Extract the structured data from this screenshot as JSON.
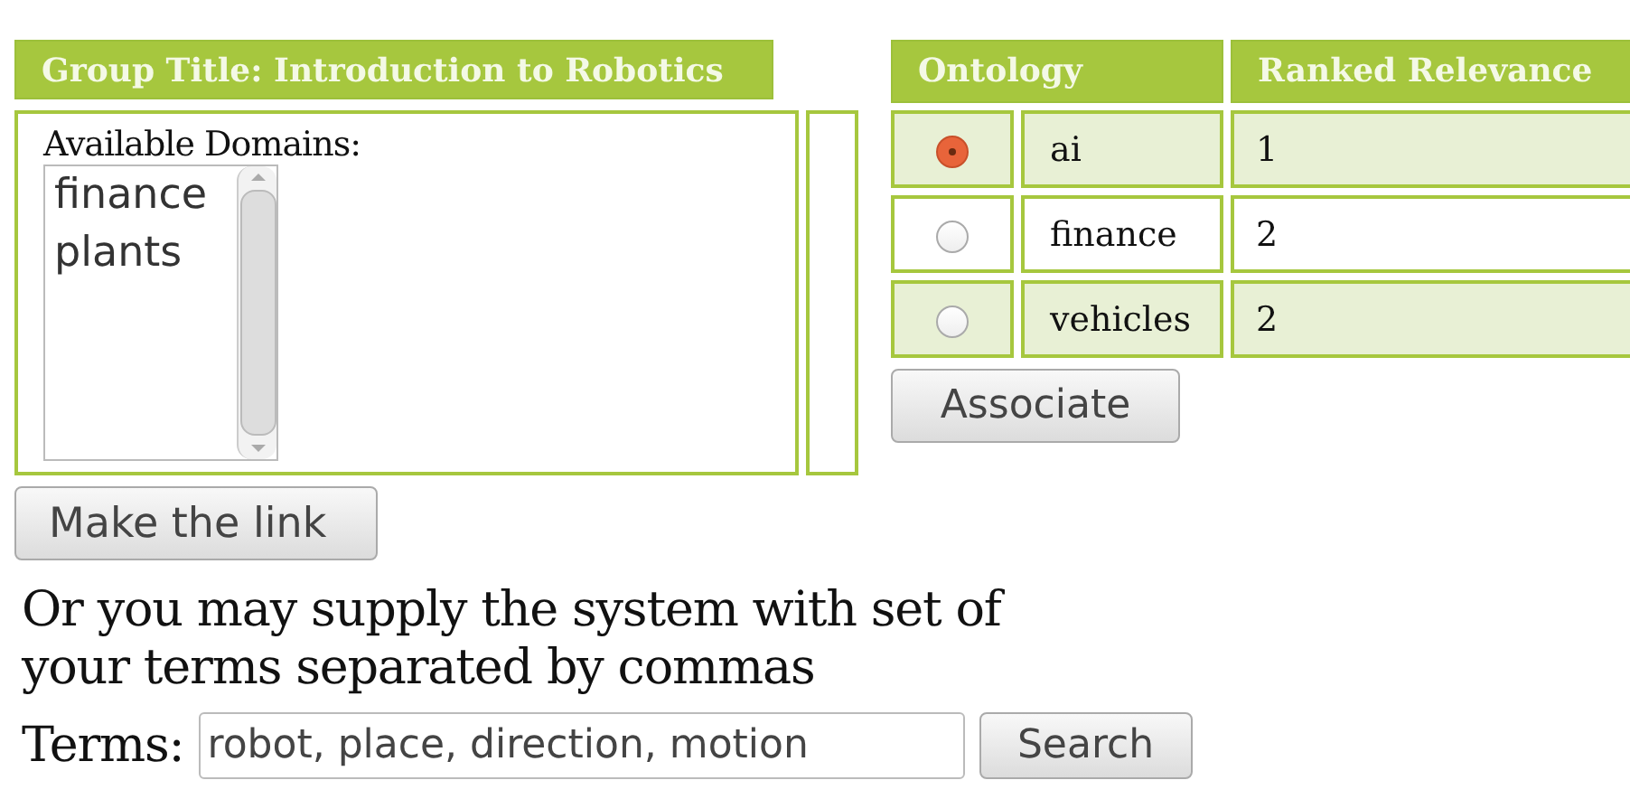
{
  "group": {
    "title": "Group Title: Introduction to Robotics",
    "domains_label": "Available Domains:",
    "domains": [
      "finance",
      "plants"
    ]
  },
  "ontology_table": {
    "columns": [
      "Ontology",
      "Ranked Relevance"
    ],
    "rows": [
      {
        "name": "ai",
        "relevance": "1",
        "selected": true
      },
      {
        "name": "finance",
        "relevance": "2",
        "selected": false
      },
      {
        "name": "vehicles",
        "relevance": "2",
        "selected": false
      }
    ]
  },
  "associate_button": "Associate",
  "link_button": "Make the link",
  "instructions": "Or you may supply the system with set of your terms separated by commas",
  "terms": {
    "label": "Terms:",
    "value": "robot, place, direction, motion"
  },
  "search_button": "Search"
}
